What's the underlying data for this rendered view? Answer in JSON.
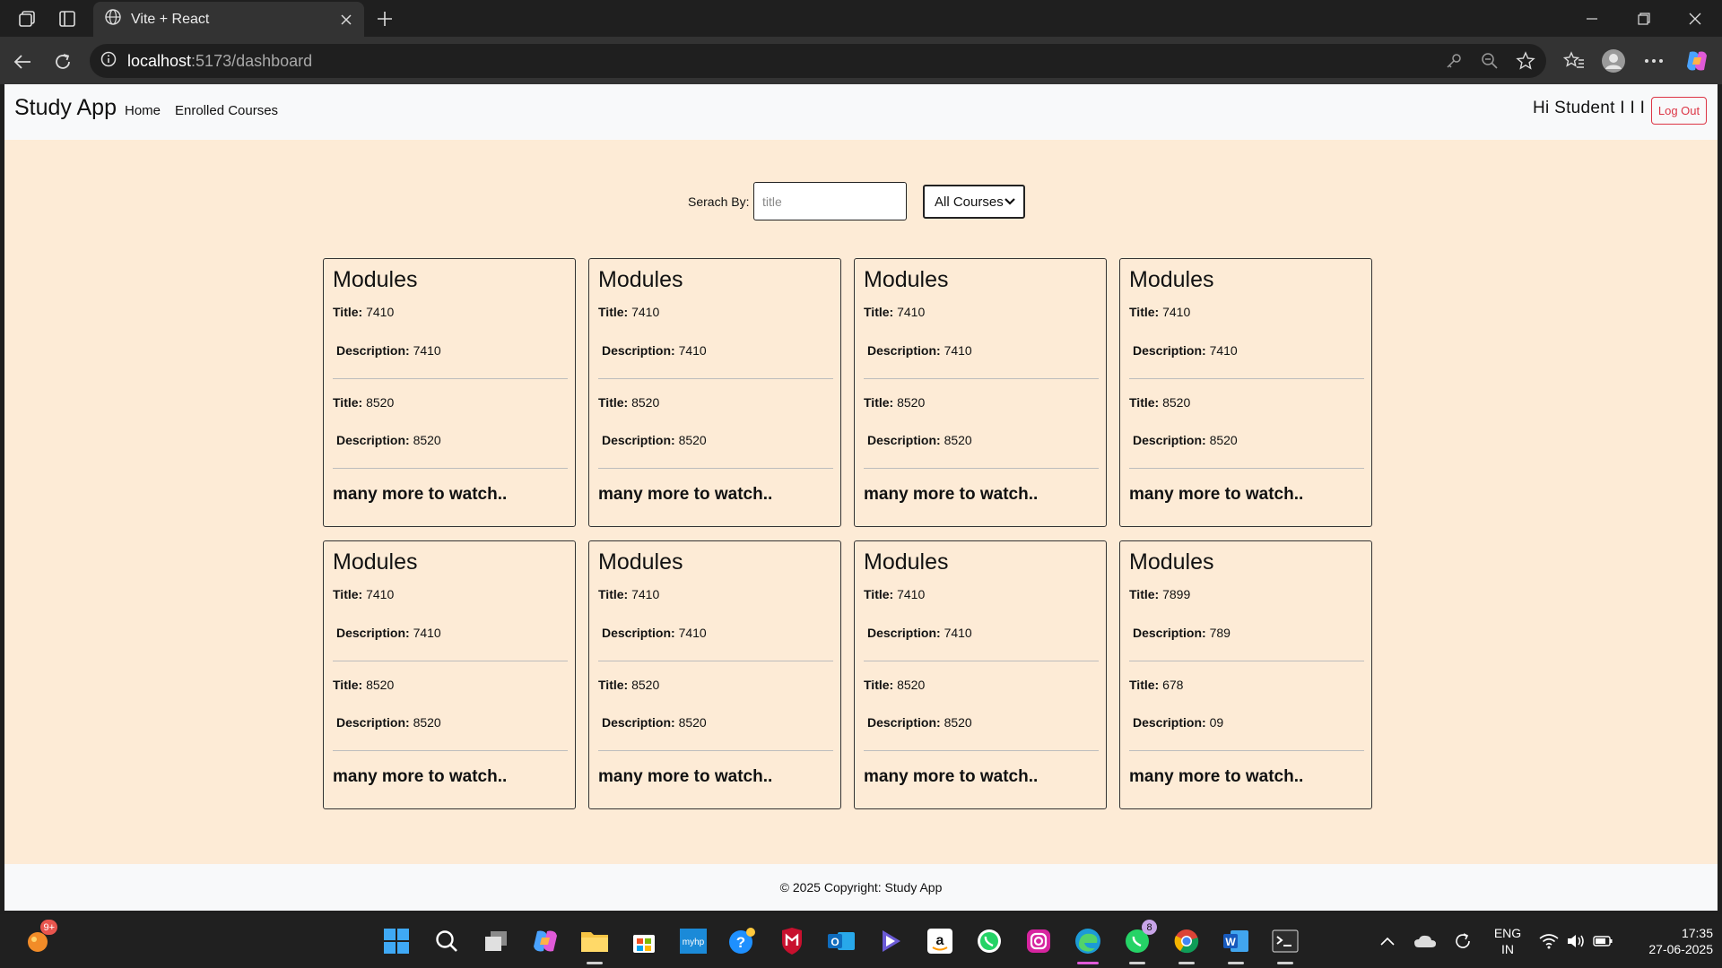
{
  "browser": {
    "tab_title": "Vite + React",
    "url_host": "localhost",
    "url_path": ":5173/dashboard"
  },
  "header": {
    "brand": "Study App",
    "nav": [
      "Home",
      "Enrolled Courses"
    ],
    "greeting": "Hi Student I I I",
    "logout_label": "Log Out"
  },
  "search": {
    "label": "Serach By:",
    "placeholder": "title",
    "filter_value": "All Courses"
  },
  "cards": [
    {
      "heading": "Modules",
      "modules": [
        {
          "title": "7410",
          "description": "7410"
        },
        {
          "title": "8520",
          "description": "8520"
        }
      ],
      "more": "many more to watch.."
    },
    {
      "heading": "Modules",
      "modules": [
        {
          "title": "7410",
          "description": "7410"
        },
        {
          "title": "8520",
          "description": "8520"
        }
      ],
      "more": "many more to watch.."
    },
    {
      "heading": "Modules",
      "modules": [
        {
          "title": "7410",
          "description": "7410"
        },
        {
          "title": "8520",
          "description": "8520"
        }
      ],
      "more": "many more to watch.."
    },
    {
      "heading": "Modules",
      "modules": [
        {
          "title": "7410",
          "description": "7410"
        },
        {
          "title": "8520",
          "description": "8520"
        }
      ],
      "more": "many more to watch.."
    },
    {
      "heading": "Modules",
      "modules": [
        {
          "title": "7410",
          "description": "7410"
        },
        {
          "title": "8520",
          "description": "8520"
        }
      ],
      "more": "many more to watch.."
    },
    {
      "heading": "Modules",
      "modules": [
        {
          "title": "7410",
          "description": "7410"
        },
        {
          "title": "8520",
          "description": "8520"
        }
      ],
      "more": "many more to watch.."
    },
    {
      "heading": "Modules",
      "modules": [
        {
          "title": "7410",
          "description": "7410"
        },
        {
          "title": "8520",
          "description": "8520"
        }
      ],
      "more": "many more to watch.."
    },
    {
      "heading": "Modules",
      "modules": [
        {
          "title": "7899",
          "description": "789"
        },
        {
          "title": "678",
          "description": "09"
        }
      ],
      "more": "many more to watch.."
    }
  ],
  "labels": {
    "title": "Title:",
    "description": "Description:"
  },
  "footer": "© 2025 Copyright: Study App",
  "taskbar": {
    "widget_badge": "9+",
    "whatsapp_badge": "8",
    "lang_line1": "ENG",
    "lang_line2": "IN",
    "time": "17:35",
    "date": "27-06-2025"
  }
}
